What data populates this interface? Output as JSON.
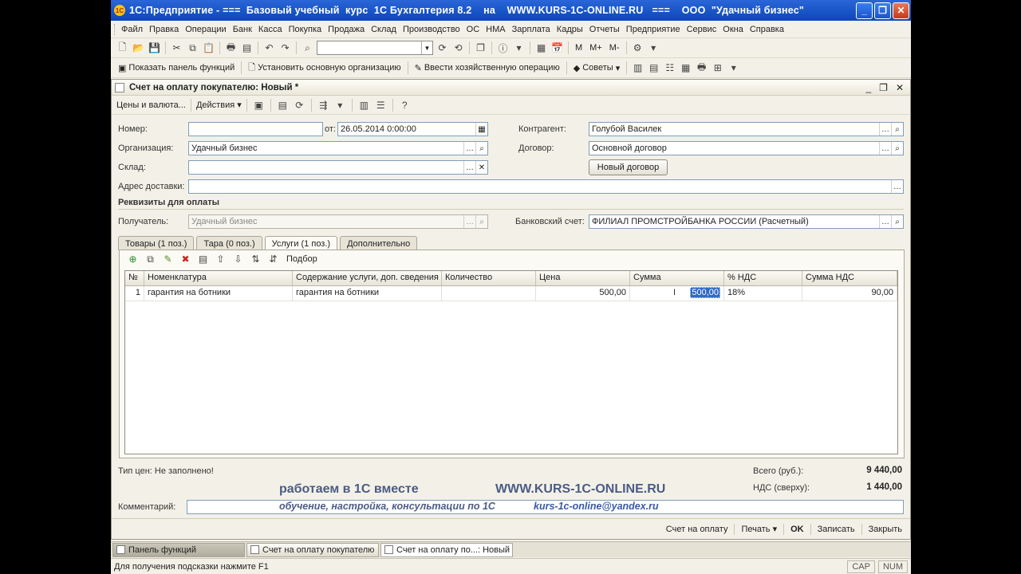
{
  "window": {
    "title": "1С:Предприятие - ===  Базовый учебный  курс  1С Бухгалтерия 8.2    на    WWW.KURS-1C-ONLINE.RU   ===    ООО  \"Удачный бизнес\"",
    "logo_text": "1С"
  },
  "menu": [
    "Файл",
    "Правка",
    "Операции",
    "Банк",
    "Касса",
    "Покупка",
    "Продажа",
    "Склад",
    "Производство",
    "ОС",
    "НМА",
    "Зарплата",
    "Кадры",
    "Отчеты",
    "Предприятие",
    "Сервис",
    "Окна",
    "Справка"
  ],
  "toolbar": {
    "calc_m": "M",
    "calc_mplus": "M+",
    "calc_mminus": "M-"
  },
  "toolbar2": {
    "show_panel": "Показать панель функций",
    "set_org": "Установить основную организацию",
    "enter_op": "Ввести хозяйственную операцию",
    "tips": "Советы"
  },
  "doc": {
    "title": "Счет на оплату покупателю: Новый *",
    "prices_currency": "Цены и валюта...",
    "actions": "Действия",
    "labels": {
      "number": "Номер:",
      "from": "от:",
      "org": "Организация:",
      "warehouse": "Склад:",
      "address": "Адрес доставки:",
      "counterparty": "Контрагент:",
      "contract": "Договор:",
      "payment_section": "Реквизиты для оплаты",
      "recipient": "Получатель:",
      "bank_account": "Банковский счет:"
    },
    "values": {
      "number": "",
      "date": "26.05.2014  0:00:00",
      "org": "Удачный бизнес",
      "warehouse": "",
      "address": "",
      "counterparty": "Голубой Василек",
      "contract": "Основной договор",
      "recipient": "Удачный бизнес",
      "bank_account": "ФИЛИАЛ ПРОМСТРОЙБАНКА РОССИИ (Расчетный)"
    },
    "new_contract_btn": "Новый договор",
    "tabs": [
      "Товары (1 поз.)",
      "Тара (0 поз.)",
      "Услуги (1 поз.)",
      "Дополнительно"
    ],
    "panel_selection": "Подбор",
    "grid": {
      "columns": [
        "№",
        "Номенклатура",
        "Содержание услуги, доп. сведения",
        "Количество",
        "Цена",
        "Сумма",
        "% НДС",
        "Сумма НДС"
      ],
      "rows": [
        {
          "n": "1",
          "item": "гарантия на ботники",
          "content": "гарантия на ботники",
          "qty": "",
          "price": "500,00",
          "sum": "500,00",
          "vat_rate": "18%",
          "vat_sum": "90,00"
        }
      ]
    },
    "price_type": "Тип цен: Не заполнено!",
    "total_label": "Всего (руб.):",
    "total_value": "9 440,00",
    "vat_label": "НДС (сверху):",
    "vat_value": "1 440,00",
    "comment_label": "Комментарий:",
    "comment_value": "",
    "bottom": {
      "invoice": "Счет на оплату",
      "print": "Печать",
      "ok": "OK",
      "save": "Записать",
      "close": "Закрыть"
    }
  },
  "watermark": {
    "line1_left": "работаем в 1С вместе",
    "line1_right": "WWW.KURS-1C-ONLINE.RU",
    "line2_left": "обучение, настройка, консультации по 1С",
    "line2_right": "kurs-1c-online@yandex.ru"
  },
  "taskbar": [
    "Панель функций",
    "Счет на оплату покупателю",
    "Счет на оплату по...: Новый *"
  ],
  "status": {
    "hint": "Для получения подсказки нажмите F1",
    "cap": "CAP",
    "num": "NUM"
  }
}
